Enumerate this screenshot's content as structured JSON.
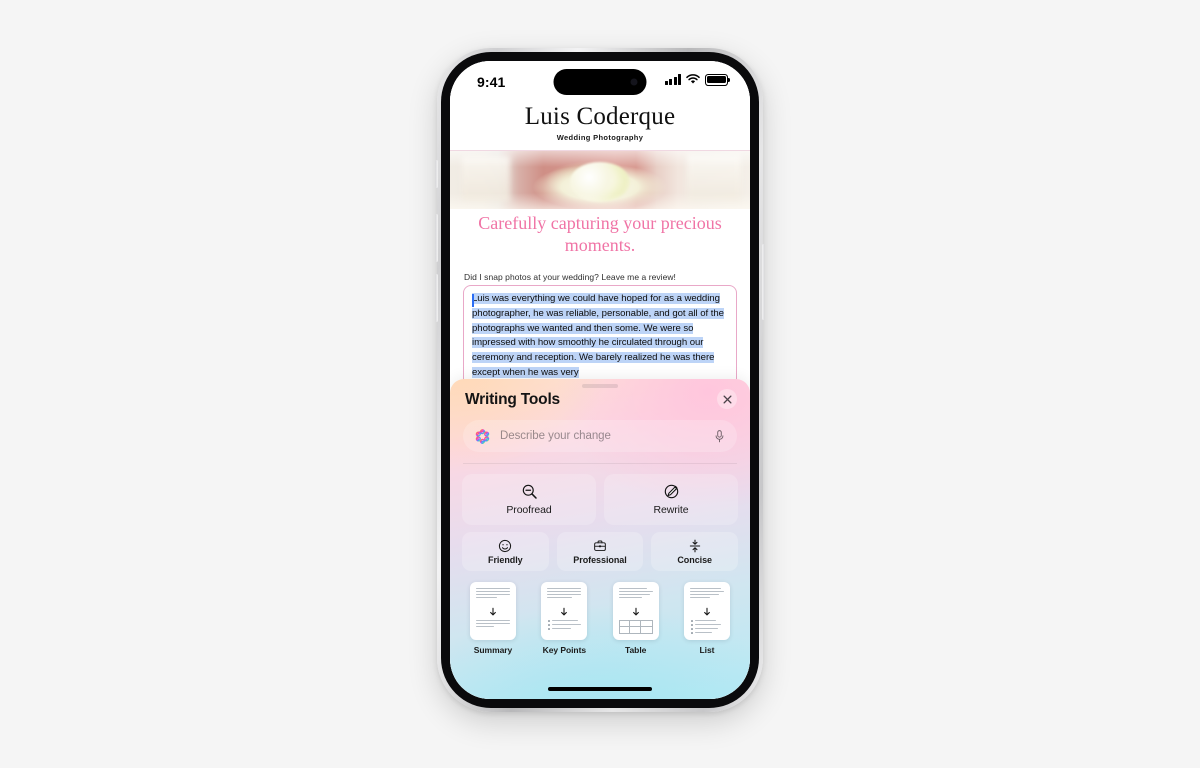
{
  "background_color": "#f5f5f5",
  "device": {
    "frame_color": "#d3d3d5",
    "buttons": [
      "action-button",
      "volume-up-button",
      "volume-down-button",
      "power-button"
    ]
  },
  "status_bar": {
    "time": "9:41",
    "cellular_icon": "signal-bars-icon",
    "wifi_icon": "wifi-icon",
    "battery_icon": "battery-full-icon"
  },
  "website": {
    "brand_name": "Luis Coderque",
    "brand_subtitle": "Wedding Photography",
    "hero_photo_alt": "bride-with-bouquet-photo",
    "tagline": "Carefully capturing your precious moments.",
    "review_prompt": "Did I snap photos at your wedding? Leave me a review!",
    "review_text": "Luis was everything we could have hoped for as a wedding photographer, he was reliable, personable, and got all of the photographs we wanted and then some. We were so impressed with how smoothly he circulated through our ceremony and reception. We barely realized he was there except when he was very",
    "selection_color": "#bdd4f7",
    "caret_color": "#2a6df5",
    "field_border_color": "#e9a8c8",
    "tagline_color": "#f074a6"
  },
  "writing_tools": {
    "title": "Writing Tools",
    "close_icon": "close-icon",
    "grabber": "sheet-drag-handle",
    "describe": {
      "placeholder": "Describe your change",
      "leading_icon": "apple-intelligence-icon",
      "trailing_icon": "microphone-icon"
    },
    "primary_actions": [
      {
        "label": "Proofread",
        "icon": "magnifier-minus-icon"
      },
      {
        "label": "Rewrite",
        "icon": "pencil-circle-icon"
      }
    ],
    "tone_actions": [
      {
        "label": "Friendly",
        "icon": "smiley-face-icon"
      },
      {
        "label": "Professional",
        "icon": "briefcase-icon"
      },
      {
        "label": "Concise",
        "icon": "compress-arrows-icon"
      }
    ],
    "document_actions": [
      {
        "label": "Summary",
        "icon": "document-summary-icon"
      },
      {
        "label": "Key Points",
        "icon": "document-key-points-icon"
      },
      {
        "label": "Table",
        "icon": "document-table-icon"
      },
      {
        "label": "List",
        "icon": "document-list-icon"
      }
    ],
    "gradient_colors": [
      "#fde3d2",
      "#fcd7e2",
      "#cfe6f0",
      "#b6e9f4"
    ]
  },
  "home_indicator": "home-indicator-bar"
}
